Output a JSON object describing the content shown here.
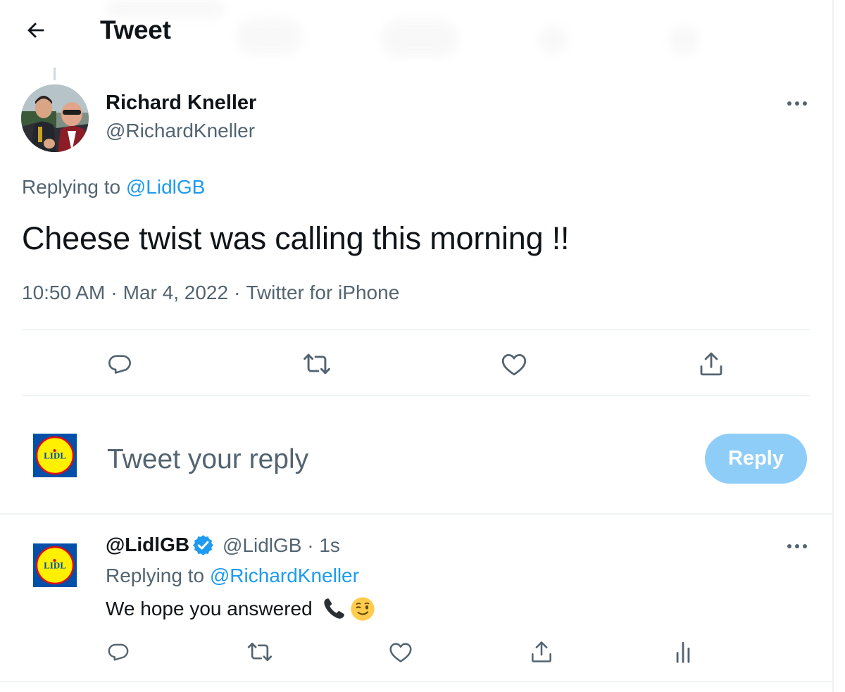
{
  "header": {
    "title": "Tweet"
  },
  "tweet": {
    "author_name": "Richard Kneller",
    "author_handle": "@RichardKneller",
    "replying_prefix": "Replying to",
    "replying_to": "@LidlGB",
    "text": "Cheese twist was calling this morning !!",
    "time": "10:50 AM",
    "date": "Mar 4, 2022",
    "source": "Twitter for iPhone",
    "separator": "·"
  },
  "actions": [
    "reply-icon",
    "retweet-icon",
    "like-icon",
    "share-icon"
  ],
  "composer": {
    "placeholder": "Tweet your reply",
    "reply_button": "Reply",
    "logo_text": "LIDL"
  },
  "reply": {
    "name": "@LidlGB",
    "handle_time": "@LidlGB · 1s",
    "replying_prefix": "Replying to",
    "replying_to": "@RichardKneller",
    "text": "We hope you answered",
    "icons": [
      "phone-emoji",
      "wink-emoji"
    ],
    "actions": [
      "reply-icon",
      "retweet-icon",
      "like-icon",
      "share-icon",
      "analytics-icon"
    ]
  },
  "colors": {
    "accent": "#1d9bf0",
    "reply_button_disabled": "#8ecdf8",
    "secondary_text": "#536471",
    "divider": "#eff3f4",
    "lidl_blue": "#0050aa",
    "lidl_yellow": "#fff000",
    "lidl_red": "#e60a14"
  }
}
